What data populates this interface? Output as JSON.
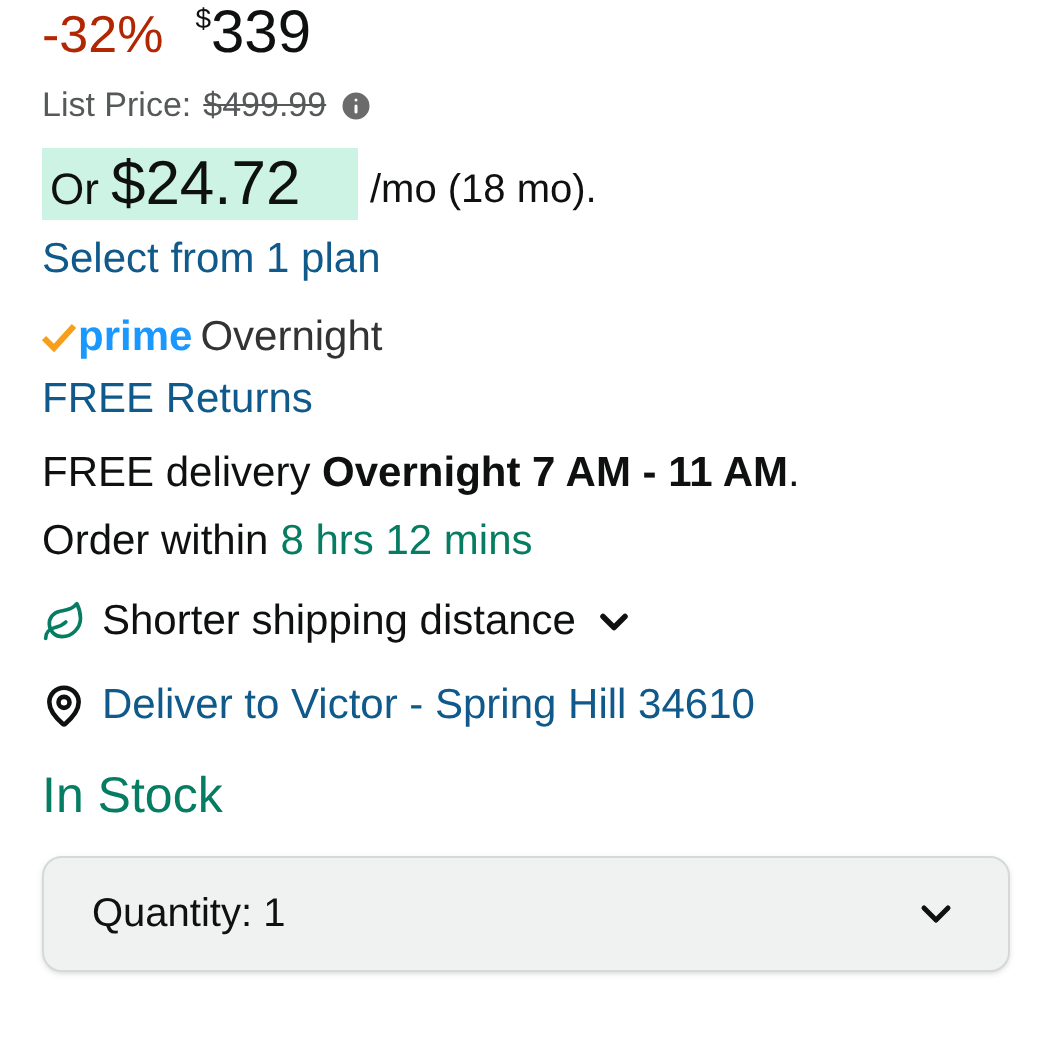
{
  "price": {
    "discount": "-32%",
    "currency": "$",
    "amount": "339"
  },
  "list_price": {
    "label": "List Price:",
    "value": "$499.99"
  },
  "installment": {
    "prefix": "Or",
    "amount": "$24.72",
    "suffix": "/mo (18 mo)."
  },
  "plan_link": "Select from 1 plan",
  "prime": {
    "brand": "prime",
    "speed": "Overnight"
  },
  "returns_link": "FREE Returns",
  "delivery": "FREE delivery **Overnight 7 AM - 11 AM**.",
  "order_within": {
    "label": "Order within",
    "countdown": "8 hrs 12 mins"
  },
  "shipping_note": {
    "text": "Shorter shipping distance",
    "expanded": false
  },
  "deliver_to": "Deliver to Victor - Spring Hill 34610",
  "stock": "In Stock",
  "quantity": {
    "label": "Quantity:",
    "value": "1"
  }
}
